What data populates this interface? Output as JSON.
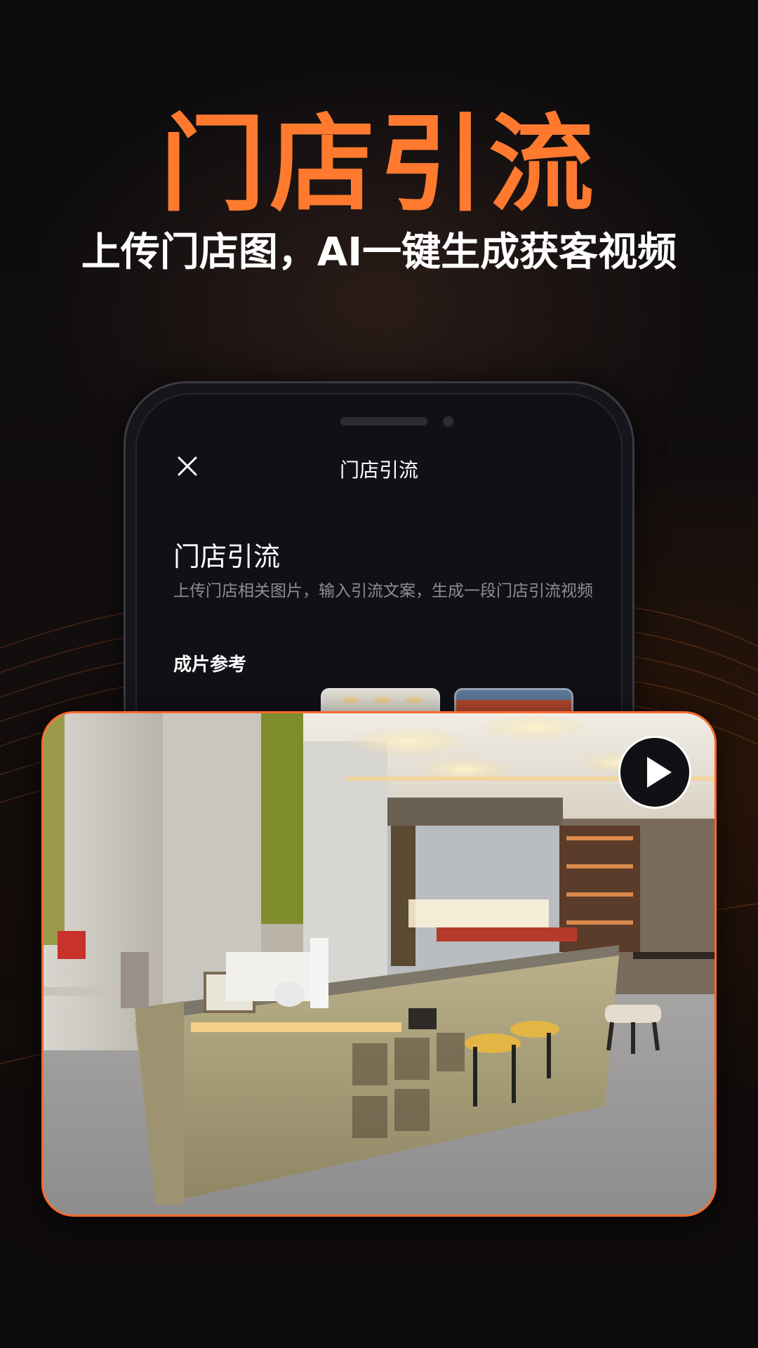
{
  "hero": {
    "title": "门店引流",
    "subtitle": "上传门店图，AI一键生成获客视频"
  },
  "colors": {
    "accent": "#ff7a2f",
    "card_border": "#ff6a2a",
    "background": "#0f0c0d"
  },
  "phone_screen": {
    "nav": {
      "close_icon": "close-icon",
      "title": "门店引流"
    },
    "page_title": "门店引流",
    "description": "上传门店相关图片，输入引流文案，生成一段门店引流视频",
    "section_label": "成片参考"
  },
  "video_preview": {
    "play_icon": "play-icon"
  }
}
